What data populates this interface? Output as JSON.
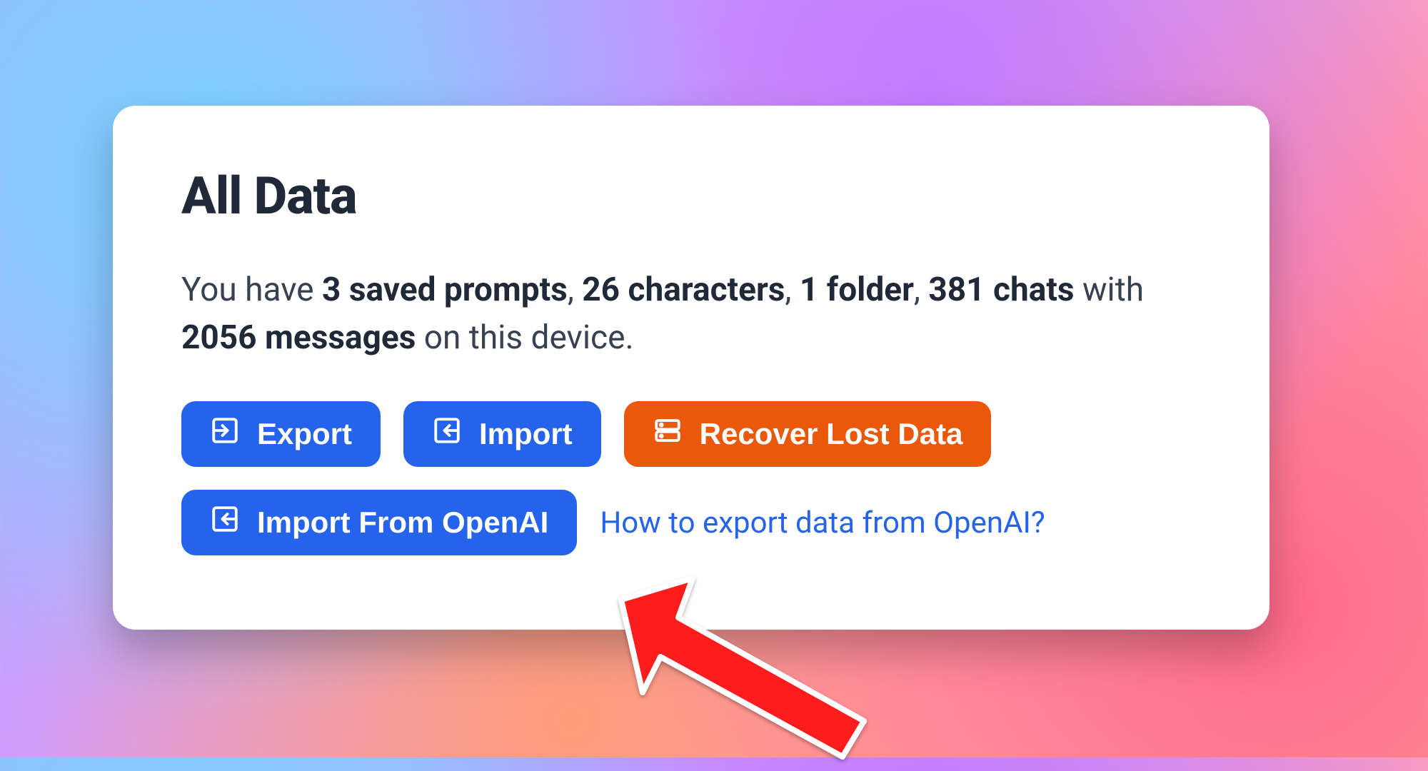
{
  "card": {
    "title": "All Data",
    "summary": {
      "prefix": "You have ",
      "prompts_count": "3",
      "prompts_label": " saved prompts",
      "sep1": ", ",
      "characters_count": "26",
      "characters_label": " characters",
      "sep2": ", ",
      "folders_count": "1",
      "folders_label": " folder",
      "sep3": ", ",
      "chats_count": "381",
      "chats_label": " chats",
      "with": " with ",
      "messages_count": "2056",
      "messages_label": " messages",
      "suffix": " on this device."
    },
    "buttons": {
      "export": "Export",
      "import": "Import",
      "recover": "Recover Lost Data",
      "import_openai": "Import From OpenAI"
    },
    "help_link": "How to export data from OpenAI?"
  }
}
